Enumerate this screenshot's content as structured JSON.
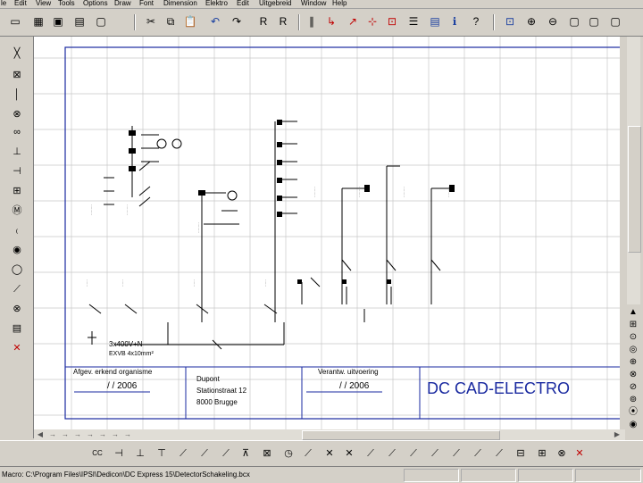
{
  "menu": [
    "le",
    "Edit",
    "View",
    "Tools",
    "Options",
    "Draw",
    "Font",
    "Dimension",
    "Elektro",
    "Edit",
    "Uitgebreid",
    "Window",
    "Help"
  ],
  "toolbar_icons": [
    "new-icon",
    "open-icon",
    "save-icon",
    "print-icon",
    "preview-icon",
    "cut-icon",
    "copy-icon",
    "paste-icon",
    "undo-icon",
    "redo-icon",
    "redraw-icon",
    "refresh-icon",
    "parallel-icon",
    "move-icon",
    "rotate-icon",
    "select-icon",
    "scale-icon",
    "layer-icon",
    "properties-icon",
    "help-icon",
    "zoom-window-icon",
    "zoom-in-icon",
    "zoom-out-icon",
    "pan-icon",
    "full-view-icon",
    "zoom-prev-icon",
    "zoom-extents-icon"
  ],
  "drawing": {
    "title_block": {
      "label_erkend": "Afgev. erkend organisme",
      "label_verantw": "Verantw. uitvoering",
      "date1": "/ / 2006",
      "date2": "/ / 2006",
      "address_lines": [
        "Dupont",
        "Stationstraat 12",
        "8000 Brugge"
      ],
      "brand": "DC CAD-ELECTRO"
    },
    "supply_label": "3x400V+N",
    "cable_label": "EXVB 4x10mm²"
  },
  "status": {
    "path": "Macro: C:\\Program Files\\IPSI\\Dedicon\\DC Express 15\\DetectorSchakeling.bcx"
  },
  "colors": {
    "drawing_frame": "#1a2aa0",
    "brand_text": "#1a2aa0",
    "delete_icon": "#c00000"
  }
}
